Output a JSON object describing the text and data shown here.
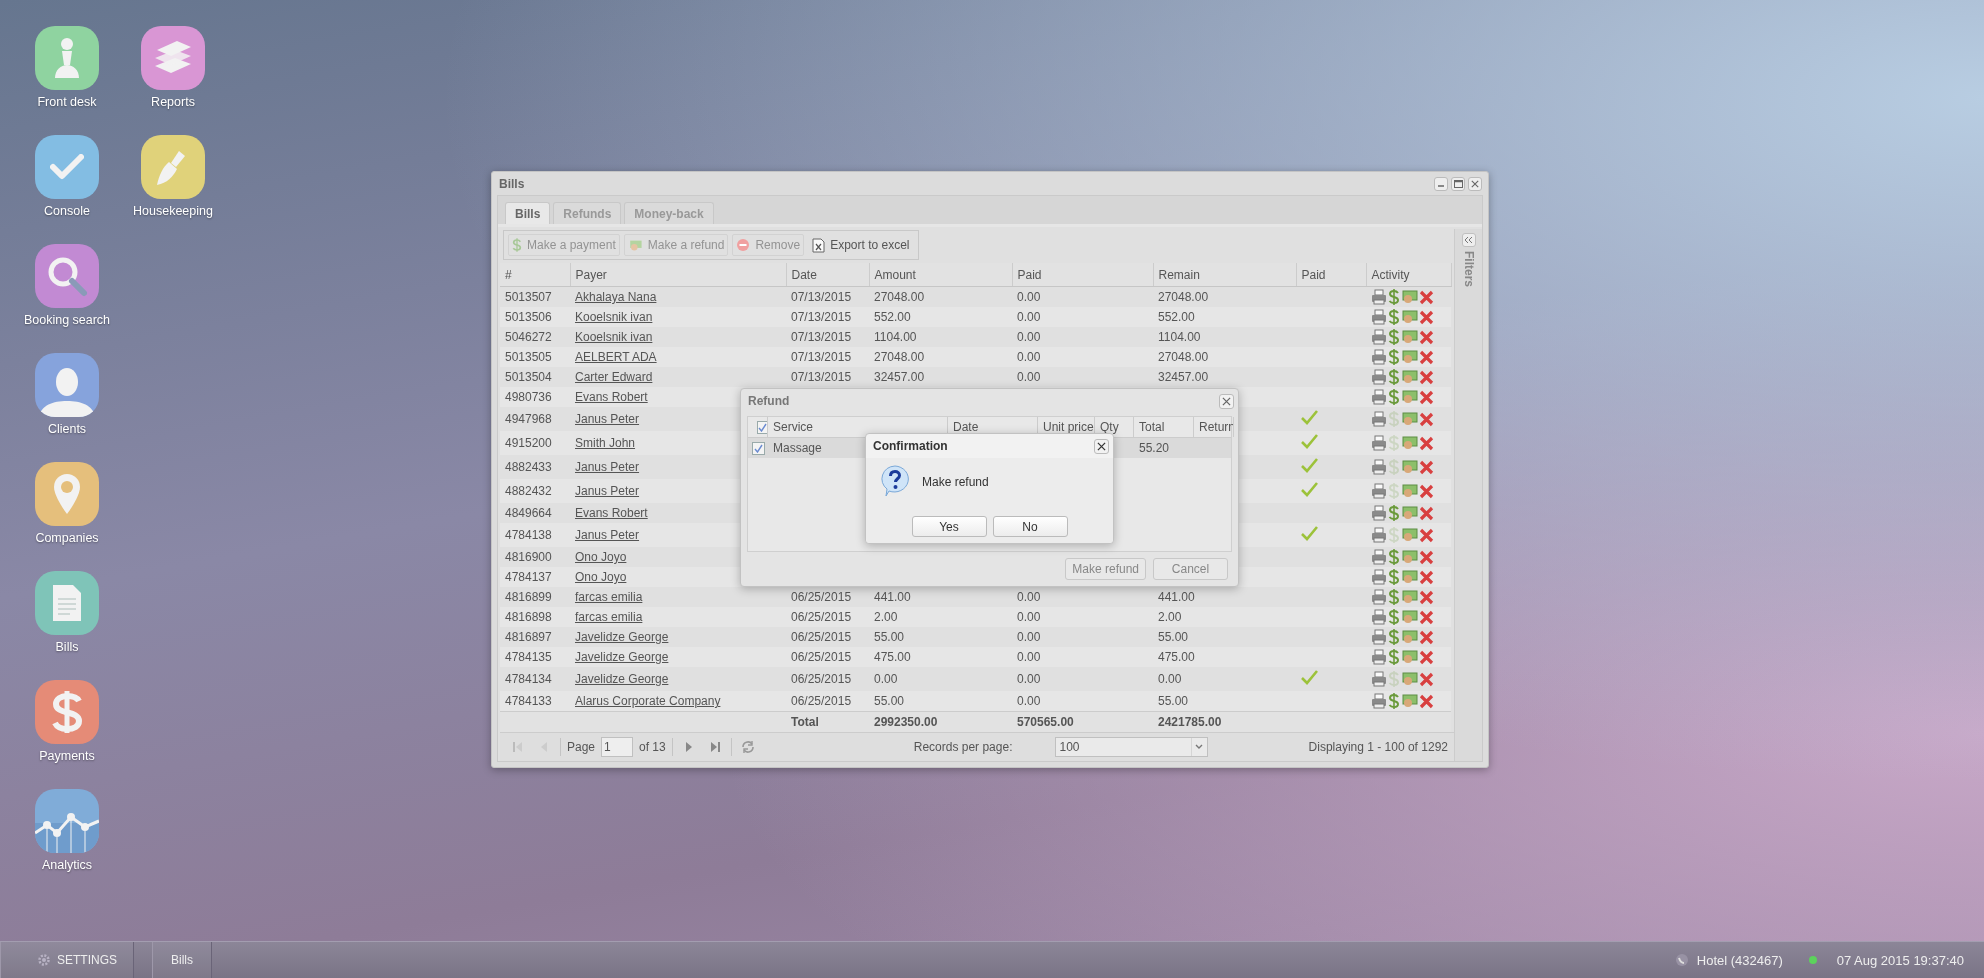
{
  "desktop_icons": [
    {
      "label": "Front desk",
      "color": "#8fd3a0"
    },
    {
      "label": "Console",
      "color": "#83bde3"
    },
    {
      "label": "Booking search",
      "color": "#c28ad3"
    },
    {
      "label": "Clients",
      "color": "#86a3dc"
    },
    {
      "label": "Companies",
      "color": "#e5bf7c"
    },
    {
      "label": "Bills",
      "color": "#7fc4b8"
    },
    {
      "label": "Payments",
      "color": "#e58b77"
    },
    {
      "label": "Analytics",
      "color": "#80acd8"
    },
    {
      "label": "Reports",
      "color": "#d996d4"
    },
    {
      "label": "Housekeeping",
      "color": "#e0d27a"
    }
  ],
  "window": {
    "title": "Bills",
    "tabs": [
      {
        "label": "Bills",
        "selected": true
      },
      {
        "label": "Refunds",
        "selected": false
      },
      {
        "label": "Money-back",
        "selected": false
      }
    ],
    "toolbar": [
      {
        "label": "Make a payment",
        "disabled": true
      },
      {
        "label": "Make a refund",
        "disabled": true
      },
      {
        "label": "Remove",
        "disabled": true
      },
      {
        "label": "Export to excel",
        "disabled": false
      }
    ],
    "columns": [
      "#",
      "Payer",
      "Date",
      "Amount",
      "Paid",
      "Remain",
      "Paid",
      "Activity"
    ],
    "rows": [
      {
        "id": "5013507",
        "payer": "Akhalaya Nana",
        "date": "07/13/2015",
        "amount": "27048.00",
        "paid_amount": "0.00",
        "remain": "27048.00",
        "paid": false
      },
      {
        "id": "5013506",
        "payer": "Kooelsnik ivan",
        "date": "07/13/2015",
        "amount": "552.00",
        "paid_amount": "0.00",
        "remain": "552.00",
        "paid": false
      },
      {
        "id": "5046272",
        "payer": "Kooelsnik ivan",
        "date": "07/13/2015",
        "amount": "1104.00",
        "paid_amount": "0.00",
        "remain": "1104.00",
        "paid": false
      },
      {
        "id": "5013505",
        "payer": "AELBERT ADA",
        "date": "07/13/2015",
        "amount": "27048.00",
        "paid_amount": "0.00",
        "remain": "27048.00",
        "paid": false
      },
      {
        "id": "5013504",
        "payer": "Carter Edward",
        "date": "07/13/2015",
        "amount": "32457.00",
        "paid_amount": "0.00",
        "remain": "32457.00",
        "paid": false
      },
      {
        "id": "4980736",
        "payer": "Evans Robert",
        "paid": false
      },
      {
        "id": "4947968",
        "payer": "Janus Peter",
        "paid": true
      },
      {
        "id": "4915200",
        "payer": "Smith John",
        "paid": true
      },
      {
        "id": "4882433",
        "payer": "Janus Peter",
        "paid": true
      },
      {
        "id": "4882432",
        "payer": "Janus Peter",
        "paid": true
      },
      {
        "id": "4849664",
        "payer": "Evans Robert",
        "paid": false
      },
      {
        "id": "4784138",
        "payer": "Janus Peter",
        "paid": true
      },
      {
        "id": "4816900",
        "payer": "Ono Joyo",
        "paid": false
      },
      {
        "id": "4784137",
        "payer": "Ono Joyo",
        "paid": false
      },
      {
        "id": "4816899",
        "payer": "farcas emilia",
        "date": "06/25/2015",
        "amount": "441.00",
        "paid_amount": "0.00",
        "remain": "441.00",
        "paid": false
      },
      {
        "id": "4816898",
        "payer": "farcas emilia",
        "date": "06/25/2015",
        "amount": "2.00",
        "paid_amount": "0.00",
        "remain": "2.00",
        "paid": false
      },
      {
        "id": "4816897",
        "payer": "Javelidze George",
        "date": "06/25/2015",
        "amount": "55.00",
        "paid_amount": "0.00",
        "remain": "55.00",
        "paid": false
      },
      {
        "id": "4784135",
        "payer": "Javelidze George",
        "date": "06/25/2015",
        "amount": "475.00",
        "paid_amount": "0.00",
        "remain": "475.00",
        "paid": false
      },
      {
        "id": "4784134",
        "payer": "Javelidze George",
        "date": "06/25/2015",
        "amount": "0.00",
        "paid_amount": "0.00",
        "remain": "0.00",
        "paid": true
      },
      {
        "id": "4784133",
        "payer": "Alarus Corporate Company",
        "date": "06/25/2015",
        "amount": "55.00",
        "paid_amount": "0.00",
        "remain": "55.00",
        "paid": false
      }
    ],
    "totals": {
      "label": "Total",
      "amount": "2992350.00",
      "paid_amount": "570565.00",
      "remain": "2421785.00"
    },
    "pager": {
      "page_label": "Page",
      "page": "1",
      "of": "of 13",
      "records_label": "Records per page:",
      "records": "100",
      "displaying": "Displaying 1 - 100 of 1292"
    },
    "filters_label": "Filters"
  },
  "refund_dialog": {
    "title": "Refund",
    "all_checked": true,
    "columns": [
      "Service",
      "Date",
      "Unit price",
      "Qty",
      "Total",
      "Return"
    ],
    "rows": [
      {
        "checked": true,
        "service": "Massage",
        "total": "55.20"
      }
    ],
    "buttons": [
      "Make refund",
      "Cancel"
    ]
  },
  "confirmation": {
    "title": "Confirmation",
    "message": "Make refund",
    "buttons": [
      "Yes",
      "No"
    ]
  },
  "taskbar": {
    "settings": "SETTINGS",
    "tasks": [
      "Bills"
    ],
    "hotel": "Hotel (432467)",
    "online": true,
    "datetime": "07 Aug 2015 19:37:40"
  }
}
